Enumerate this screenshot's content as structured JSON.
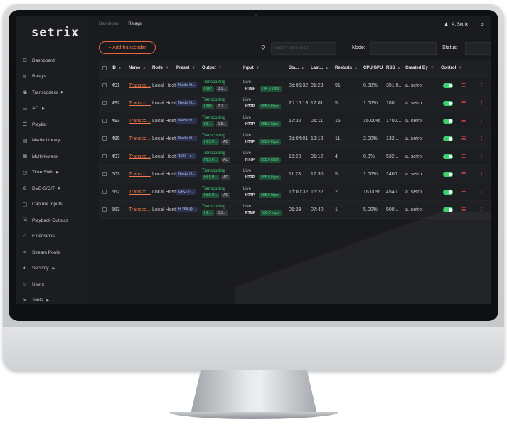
{
  "app": {
    "logo": "setrix"
  },
  "breadcrumb": {
    "parent": "Dashboard",
    "separator": "·",
    "current": "Relays"
  },
  "user": {
    "name": "A. Setrix",
    "user_icon": "user-icon",
    "logout_icon": "logout-icon"
  },
  "sidebar": {
    "items": [
      {
        "label": "Dashboard",
        "icon": "⊟",
        "caret": ""
      },
      {
        "label": "Relays",
        "icon": "⇅",
        "caret": ""
      },
      {
        "label": "Transcoders",
        "icon": "◉",
        "caret": "▶"
      },
      {
        "label": "AD",
        "icon": "▭",
        "caret": "▶"
      },
      {
        "label": "Playlist",
        "icon": "☰",
        "caret": ""
      },
      {
        "label": "Media Library",
        "icon": "▤",
        "caret": ""
      },
      {
        "label": "Multiviewers",
        "icon": "▦",
        "caret": ""
      },
      {
        "label": "Time Shift",
        "icon": "◷",
        "caret": "▶"
      },
      {
        "label": "DVB-S/C/T",
        "icon": "⊘",
        "caret": "▶"
      },
      {
        "label": "Capture Inputs",
        "icon": "▢",
        "caret": ""
      },
      {
        "label": "Playback Outputs",
        "icon": "⦿",
        "caret": ""
      },
      {
        "label": "Extensions",
        "icon": "⌂",
        "caret": ""
      },
      {
        "label": "Stream Pools",
        "icon": "≡",
        "caret": ""
      },
      {
        "label": "Security",
        "icon": "◐",
        "caret": "▶"
      },
      {
        "label": "Users",
        "icon": "☺",
        "caret": ""
      },
      {
        "label": "Tools",
        "icon": "✕",
        "caret": "▶"
      }
    ]
  },
  "toolbar": {
    "add_label": "+ Add transcoder",
    "search_placeholder": "Enter Name or ID",
    "node_label": "Node:",
    "status_label": "Status:"
  },
  "table": {
    "headers": {
      "id": "ID",
      "name": "Name",
      "node": "Node",
      "preset": "Preset",
      "output": "Output",
      "input": "Input",
      "status": "Sta...",
      "last": "Last...",
      "restarts": "Restarts",
      "cpu": "CPU/GPU",
      "rss": "RSS",
      "created_by": "Created By",
      "control": "Control"
    },
    "rows": [
      {
        "id": "491",
        "name": "Transco...",
        "node": "Local Host",
        "preset": "Nvidia H...",
        "out_title": "Transcoding",
        "out_tags": [
          "UDP",
          "3.0..."
        ],
        "in_title": "Live",
        "in_proto": "RTMP",
        "in_rate": "704.0 kbps",
        "status": "3d:06:32",
        "last": "01:23",
        "restarts": "91",
        "cpu": "0.88%",
        "rss": "391.0...",
        "created_by": "a. setrix"
      },
      {
        "id": "492",
        "name": "Transco...",
        "node": "Local Host",
        "preset": "Nvidia H...",
        "out_title": "Transcoding",
        "out_tags": [
          "UDP",
          "2.1..."
        ],
        "in_title": "Live",
        "in_proto": "HTTP",
        "in_rate": "555.0 kbps",
        "status": "2d:15:13",
        "last": "12:01",
        "restarts": "5",
        "cpu": "1.00%",
        "rss": "100...",
        "created_by": "a. setrix"
      },
      {
        "id": "493",
        "name": "Transco...",
        "node": "Local Host",
        "preset": "Nvidia H...",
        "out_title": "Transcoding",
        "out_tags": [
          "HL...",
          "1.5..."
        ],
        "in_title": "Live",
        "in_proto": "HTTP",
        "in_rate": "555.0 kbps",
        "status": "17:32",
        "last": "01:11",
        "restarts": "16",
        "cpu": "16.00%",
        "rss": "1700...",
        "created_by": "a. setrix"
      },
      {
        "id": "495",
        "name": "Transco...",
        "node": "Local Host",
        "preset": "Nvidia H...",
        "out_title": "Transcoding",
        "out_tags": [
          "HLS P...",
          "AD"
        ],
        "in_title": "Live",
        "in_proto": "HTTP",
        "in_rate": "555.0 kbps",
        "status": "2d:04:01",
        "last": "12:12",
        "restarts": "11",
        "cpu": "2.00%",
        "rss": "132...",
        "created_by": "a. setrix"
      },
      {
        "id": "497",
        "name": "Transco...",
        "node": "Local Host",
        "preset": "1500 - c...",
        "out_title": "Transcoding",
        "out_tags": [
          "HLS P...",
          "AD"
        ],
        "in_title": "Live",
        "in_proto": "HTTP",
        "in_rate": "555.0 kbps",
        "status": "15:20",
        "last": "01:12",
        "restarts": "4",
        "cpu": "0.3%",
        "rss": "532...",
        "created_by": "a. setrix"
      },
      {
        "id": "503",
        "name": "Transco...",
        "node": "Local Host",
        "preset": "Nvidia H...",
        "out_title": "Transcoding",
        "out_tags": [
          "HLS P...",
          "AD"
        ],
        "in_title": "Live",
        "in_proto": "HTTP",
        "in_rate": "555.0 kbps",
        "status": "11:23",
        "last": "17:30",
        "restarts": "5",
        "cpu": "1.00%",
        "rss": "1400...",
        "created_by": "a. setrix"
      },
      {
        "id": "562",
        "name": "Transco...",
        "node": "Local Host",
        "preset": "GPU-2-...",
        "out_title": "Transcoding",
        "out_tags": [
          "HLS P...",
          "AD"
        ],
        "in_title": "Live",
        "in_proto": "HTTP",
        "in_rate": "555.0 kbps",
        "status": "1d:00:32",
        "last": "15:22",
        "restarts": "2",
        "cpu": "16.00%",
        "rss": "4540...",
        "created_by": "a. setrix"
      },
      {
        "id": "563",
        "name": "Transco...",
        "node": "Local Host",
        "preset": "H.264 @...",
        "out_title": "Transcoding",
        "out_tags": [
          "HL...",
          "1.5..."
        ],
        "in_title": "Live",
        "in_proto": "RTMP",
        "in_rate": "555.0 kbps",
        "status": "01:23",
        "last": "07:40",
        "restarts": "1",
        "cpu": "5.00%",
        "rss": "500...",
        "created_by": "a. setrix"
      }
    ]
  },
  "colors": {
    "accent": "#f07a4b",
    "live_green": "#43d17a",
    "toggle_on": "#3ecf70",
    "danger": "#e5484d",
    "screen_bg": "#1a1b1e"
  }
}
